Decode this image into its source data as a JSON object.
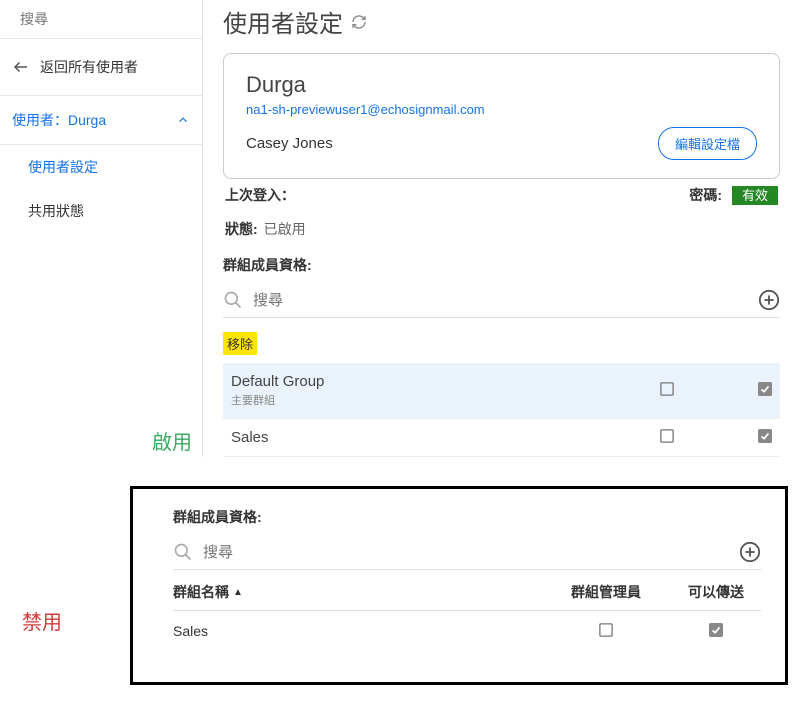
{
  "sidebar": {
    "search_placeholder": "搜尋",
    "back_label": "返回所有使用者",
    "expand_label": "使用者：Durga",
    "items": [
      {
        "label": "使用者設定"
      },
      {
        "label": "共用狀態"
      }
    ]
  },
  "page": {
    "title": "使用者設定"
  },
  "user_card": {
    "name": "Durga",
    "email": "na1-sh-previewuser1@echosignmail.com",
    "fullname": "Casey Jones",
    "edit_button": "編輯設定檔"
  },
  "info": {
    "last_login_label": "上次登入：",
    "password_label": "密碼:",
    "password_status": "有效",
    "status_label": "狀態:",
    "status_value": "已啟用"
  },
  "groups": {
    "label": "群組成員資格:",
    "search_placeholder": "搜尋",
    "remove_tag": "移除",
    "rows": [
      {
        "name": "Default Group",
        "sub": "主要群組",
        "admin": false,
        "send": true,
        "highlighted": true
      },
      {
        "name": "Sales",
        "admin": false,
        "send": true,
        "highlighted": false
      }
    ]
  },
  "annotations": {
    "enable": "啟用",
    "disable": "禁用"
  },
  "bottom_panel": {
    "label": "群組成員資格:",
    "search_placeholder": "搜尋",
    "headers": {
      "name": "群組名稱",
      "admin": "群組管理員",
      "send": "可以傳送"
    },
    "rows": [
      {
        "name": "Sales",
        "admin": false,
        "send": true
      }
    ]
  }
}
